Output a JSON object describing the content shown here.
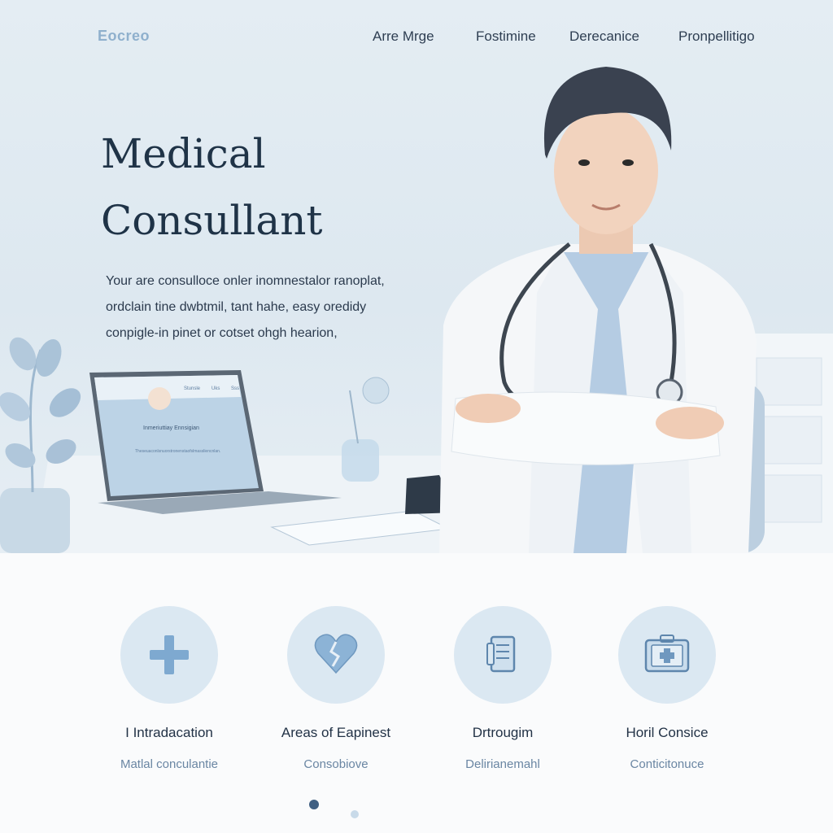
{
  "nav": {
    "logo": "Eocreo",
    "links": [
      "Arre Mrge",
      "Fostimine",
      "Derecanice",
      "Pronpellitigo"
    ]
  },
  "hero": {
    "title_line1": "Medical",
    "title_line2": "Consullant",
    "desc_line1": "Your are consulloce onler inomnestalor ranoplat,",
    "desc_line2": "ordclain tine dwbtmil, tant hahe, easy oredidy",
    "desc_line3": "conpigle-in pinet or cotset ohgh hearion,"
  },
  "laptop": {
    "nav_items": [
      "Stunsle",
      "Uks",
      "Sss"
    ],
    "heading": "Inmeriuttiay Ennsigian",
    "text": "Theseuaconlsnuorstronenstaofslmassliencnlan."
  },
  "features": [
    {
      "icon": "medical-cross-icon",
      "title": "I Intradacation",
      "subtitle": "Matlal conculantie"
    },
    {
      "icon": "broken-heart-icon",
      "title": "Areas of Eapinest",
      "subtitle": "Consobiove"
    },
    {
      "icon": "document-icon",
      "title": "Drtrougim",
      "subtitle": "Delirianemahl"
    },
    {
      "icon": "first-aid-kit-icon",
      "title": "Horil Consice",
      "subtitle": "Conticitonuce"
    }
  ],
  "pagination": {
    "active_index": 0,
    "count": 2
  },
  "colors": {
    "accent": "#7ea9d0",
    "dark_text": "#1f3347",
    "icon_bg": "#dbe8f2"
  }
}
